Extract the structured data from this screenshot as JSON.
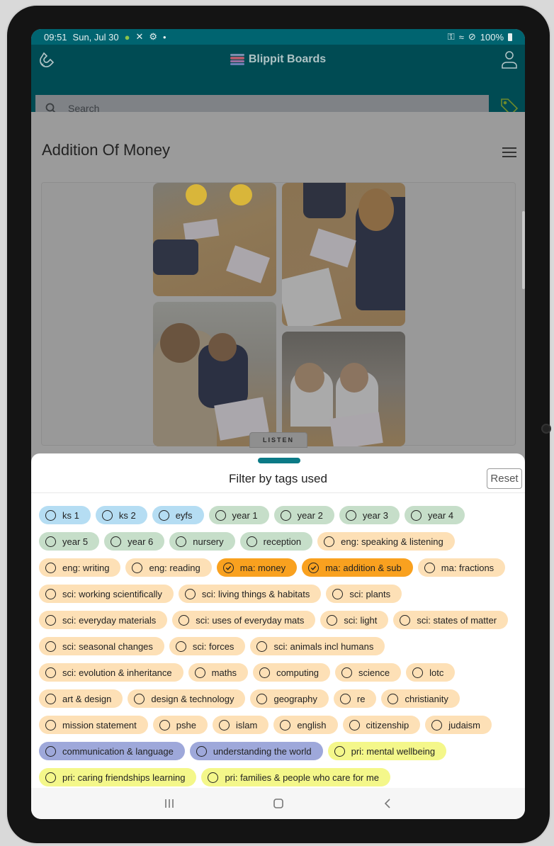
{
  "status_bar": {
    "time": "09:51",
    "date": "Sun, Jul 30",
    "battery": "100%"
  },
  "app": {
    "title": "Blippit Boards"
  },
  "search": {
    "placeholder": "Search",
    "value": ""
  },
  "board": {
    "title": "Addition Of Money",
    "listen_label": "LISTEN"
  },
  "filter_sheet": {
    "title": "Filter by tags used",
    "reset_label": "Reset",
    "colors": {
      "blue": "#b5ddf3",
      "green": "#c6dec9",
      "peach": "#fde0b6",
      "orange": "#f9a11f",
      "indigo": "#9ea8da",
      "yellow": "#f4f78a"
    },
    "tags": [
      {
        "label": "ks 1",
        "color": "blue",
        "selected": false
      },
      {
        "label": "ks 2",
        "color": "blue",
        "selected": false
      },
      {
        "label": "eyfs",
        "color": "blue",
        "selected": false
      },
      {
        "label": "year 1",
        "color": "green",
        "selected": false
      },
      {
        "label": "year 2",
        "color": "green",
        "selected": false
      },
      {
        "label": "year 3",
        "color": "green",
        "selected": false
      },
      {
        "label": "year 4",
        "color": "green",
        "selected": false
      },
      {
        "label": "year 5",
        "color": "green",
        "selected": false
      },
      {
        "label": "year 6",
        "color": "green",
        "selected": false
      },
      {
        "label": "nursery",
        "color": "green",
        "selected": false
      },
      {
        "label": "reception",
        "color": "green",
        "selected": false
      },
      {
        "label": "eng: speaking & listening",
        "color": "peach",
        "selected": false
      },
      {
        "label": "eng: writing",
        "color": "peach",
        "selected": false
      },
      {
        "label": "eng: reading",
        "color": "peach",
        "selected": false
      },
      {
        "label": "ma: money",
        "color": "orange",
        "selected": true
      },
      {
        "label": "ma: addition & sub",
        "color": "orange",
        "selected": true
      },
      {
        "label": "ma: fractions",
        "color": "peach",
        "selected": false
      },
      {
        "label": "sci: working scientifically",
        "color": "peach",
        "selected": false
      },
      {
        "label": "sci: living things & habitats",
        "color": "peach",
        "selected": false
      },
      {
        "label": "sci: plants",
        "color": "peach",
        "selected": false
      },
      {
        "label": "sci: everyday materials",
        "color": "peach",
        "selected": false
      },
      {
        "label": "sci: uses of everyday mats",
        "color": "peach",
        "selected": false
      },
      {
        "label": "sci: light",
        "color": "peach",
        "selected": false
      },
      {
        "label": "sci: states of matter",
        "color": "peach",
        "selected": false
      },
      {
        "label": "sci: seasonal changes",
        "color": "peach",
        "selected": false
      },
      {
        "label": "sci: forces",
        "color": "peach",
        "selected": false
      },
      {
        "label": "sci: animals incl humans",
        "color": "peach",
        "selected": false
      },
      {
        "label": "sci: evolution & inheritance",
        "color": "peach",
        "selected": false
      },
      {
        "label": "maths",
        "color": "peach",
        "selected": false
      },
      {
        "label": "computing",
        "color": "peach",
        "selected": false
      },
      {
        "label": "science",
        "color": "peach",
        "selected": false
      },
      {
        "label": "lotc",
        "color": "peach",
        "selected": false
      },
      {
        "label": "art & design",
        "color": "peach",
        "selected": false
      },
      {
        "label": "design & technology",
        "color": "peach",
        "selected": false
      },
      {
        "label": "geography",
        "color": "peach",
        "selected": false
      },
      {
        "label": "re",
        "color": "peach",
        "selected": false
      },
      {
        "label": "christianity",
        "color": "peach",
        "selected": false
      },
      {
        "label": "mission statement",
        "color": "peach",
        "selected": false
      },
      {
        "label": "pshe",
        "color": "peach",
        "selected": false
      },
      {
        "label": "islam",
        "color": "peach",
        "selected": false
      },
      {
        "label": "english",
        "color": "peach",
        "selected": false
      },
      {
        "label": "citizenship",
        "color": "peach",
        "selected": false
      },
      {
        "label": "judaism",
        "color": "peach",
        "selected": false
      },
      {
        "label": "communication & language",
        "color": "indigo",
        "selected": false
      },
      {
        "label": "understanding the world",
        "color": "indigo",
        "selected": false
      },
      {
        "label": "pri: mental wellbeing",
        "color": "yellow",
        "selected": false
      },
      {
        "label": "pri: caring friendships learning",
        "color": "yellow",
        "selected": false
      },
      {
        "label": "pri: families & people who care for me",
        "color": "yellow",
        "selected": false
      }
    ]
  },
  "nav_bar": {
    "buttons": [
      "recents-icon",
      "home-icon",
      "back-icon"
    ]
  }
}
